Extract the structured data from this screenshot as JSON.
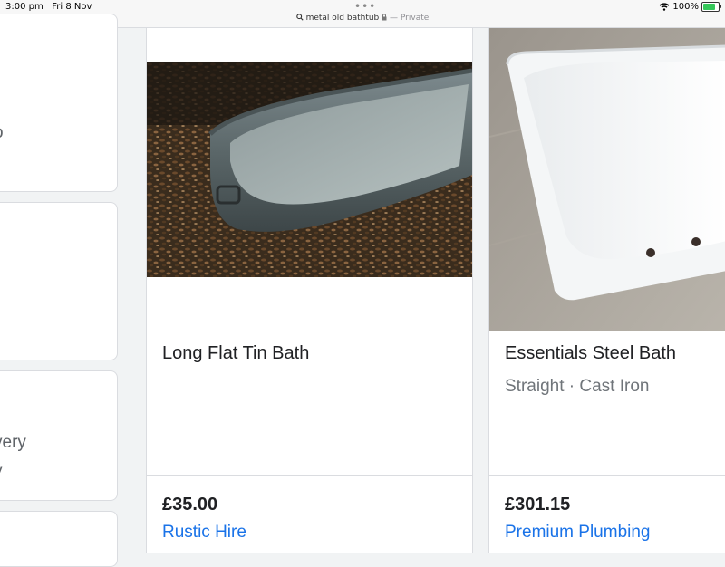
{
  "status_bar": {
    "time": "3:00 pm",
    "date": "Fri 8 Nov",
    "url_query": "metal old bathtub",
    "private_label": "— Private",
    "battery": "100%",
    "battery_level": 1.0
  },
  "left_column": {
    "fragment_1": "o",
    "fragment_2": "very",
    "fragment_3": "y"
  },
  "products": [
    {
      "title": "Long Flat Tin Bath",
      "subtitle": "",
      "price": "£35.00",
      "seller": "Rustic Hire",
      "image": "galvanized-tin-bath-photo"
    },
    {
      "title": "Essentials Steel Bath",
      "subtitle": "Straight · Cast Iron",
      "price": "£301.15",
      "seller": "Premium Plumbing",
      "image": "white-steel-bath-photo"
    }
  ],
  "colors": {
    "link": "#1a73e8",
    "border": "#dadce0",
    "muted_text": "#70757a"
  }
}
